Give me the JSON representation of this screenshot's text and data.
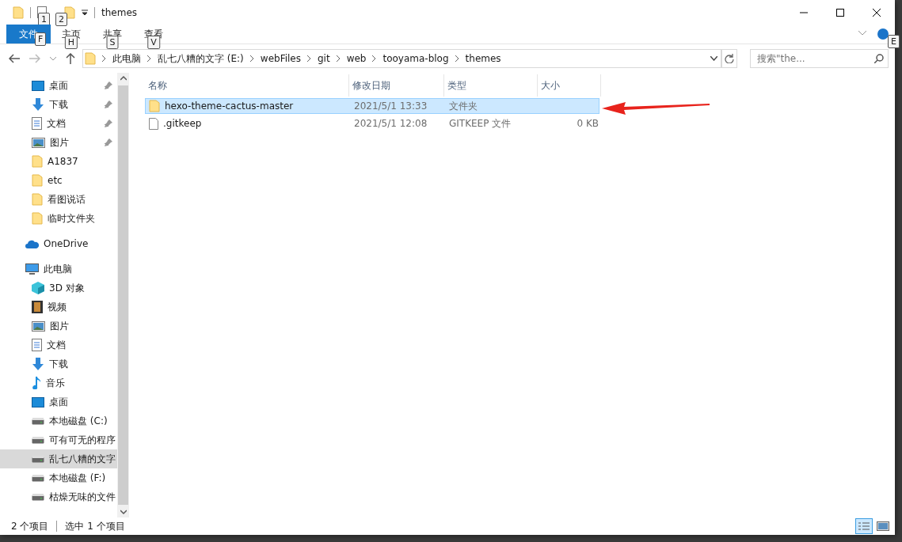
{
  "window": {
    "title": "themes",
    "quick_access_keytips": [
      "1",
      "2"
    ]
  },
  "ribbon": {
    "tabs": [
      {
        "label": "文件",
        "keytip": "F",
        "kind": "file"
      },
      {
        "label": "主页",
        "keytip": "H",
        "kind": "tab"
      },
      {
        "label": "共享",
        "keytip": "S",
        "kind": "tab"
      },
      {
        "label": "查看",
        "keytip": "V",
        "kind": "tab"
      }
    ],
    "help_keytip": "E"
  },
  "address_bar": {
    "path": [
      "此电脑",
      "乱七八糟的文字 (E:)",
      "webFiles",
      "git",
      "web",
      "tooyama-blog",
      "themes"
    ]
  },
  "search": {
    "placeholder": "搜索\"the..."
  },
  "nav_pane": {
    "items": [
      {
        "label": "桌面",
        "kind": "desktop",
        "pinned": true,
        "selected": false
      },
      {
        "label": "下载",
        "kind": "download",
        "pinned": true,
        "selected": false
      },
      {
        "label": "文档",
        "kind": "document",
        "pinned": true,
        "selected": false
      },
      {
        "label": "图片",
        "kind": "picture",
        "pinned": true,
        "selected": false
      },
      {
        "label": "A1837",
        "kind": "folder",
        "pinned": false,
        "selected": false
      },
      {
        "label": "etc",
        "kind": "folder",
        "pinned": false,
        "selected": false
      },
      {
        "label": "看图说话",
        "kind": "folder",
        "pinned": false,
        "selected": false
      },
      {
        "label": "临时文件夹",
        "kind": "folder",
        "pinned": false,
        "selected": false
      }
    ],
    "roots": [
      {
        "label": "OneDrive",
        "kind": "cloud",
        "selected": false
      },
      {
        "label": "此电脑",
        "kind": "pc",
        "selected": false,
        "children": [
          {
            "label": "3D 对象",
            "kind": "cube",
            "selected": false
          },
          {
            "label": "视频",
            "kind": "video",
            "selected": false
          },
          {
            "label": "图片",
            "kind": "picture",
            "selected": false
          },
          {
            "label": "文档",
            "kind": "document",
            "selected": false
          },
          {
            "label": "下载",
            "kind": "download",
            "selected": false
          },
          {
            "label": "音乐",
            "kind": "music",
            "selected": false
          },
          {
            "label": "桌面",
            "kind": "desktop",
            "selected": false
          },
          {
            "label": "本地磁盘 (C:)",
            "kind": "drive",
            "selected": false
          },
          {
            "label": "可有可无的程序",
            "kind": "drive",
            "selected": false
          },
          {
            "label": "乱七八糟的文字",
            "kind": "drive",
            "selected": true
          },
          {
            "label": "本地磁盘 (F:)",
            "kind": "drive",
            "selected": false
          },
          {
            "label": "枯燥无味的文件",
            "kind": "drive",
            "selected": false
          }
        ]
      }
    ]
  },
  "file_list": {
    "columns": [
      "名称",
      "修改日期",
      "类型",
      "大小"
    ],
    "rows": [
      {
        "name": "hexo-theme-cactus-master",
        "modified": "2021/5/1 13:33",
        "type": "文件夹",
        "kind": "folder",
        "selected": true
      },
      {
        "name": ".gitkeep",
        "modified": "2021/5/1 12:08",
        "type": "GITKEEP 文件",
        "size": "0 KB",
        "kind": "file",
        "selected": false
      }
    ]
  },
  "status_bar": {
    "item_count": "2 个项目",
    "selection": "选中 1 个项目",
    "views": [
      {
        "kind": "details",
        "selected": true
      },
      {
        "kind": "thumbnails",
        "selected": false
      }
    ]
  }
}
